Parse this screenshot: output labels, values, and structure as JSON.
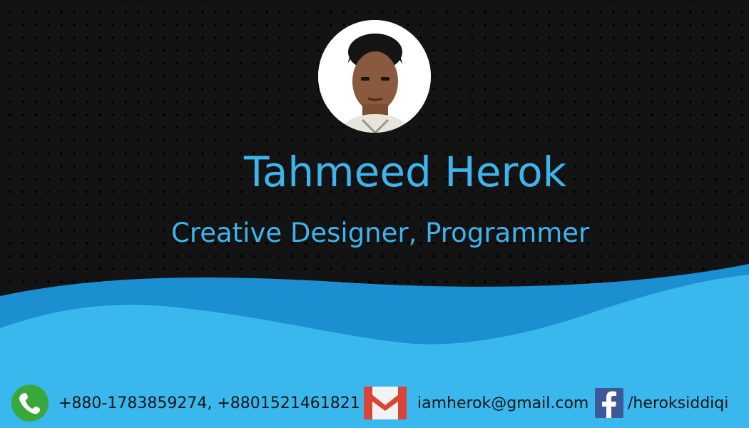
{
  "profile": {
    "name": "Tahmeed Herok",
    "role": "Creative Designer, Programmer"
  },
  "contact": {
    "phone": "+880-1783859274, +8801521461821",
    "email": "iamherok@gmail.com",
    "facebook": "/heroksiddiqi"
  },
  "colors": {
    "background": "#131313",
    "accent": "#3fb4ec",
    "wave_dark": "#1b8fd0",
    "wave_light": "#3ab8ee",
    "text_dark": "#151515"
  },
  "icons": {
    "phone": "phone-icon",
    "email": "gmail-icon",
    "facebook": "facebook-icon"
  }
}
